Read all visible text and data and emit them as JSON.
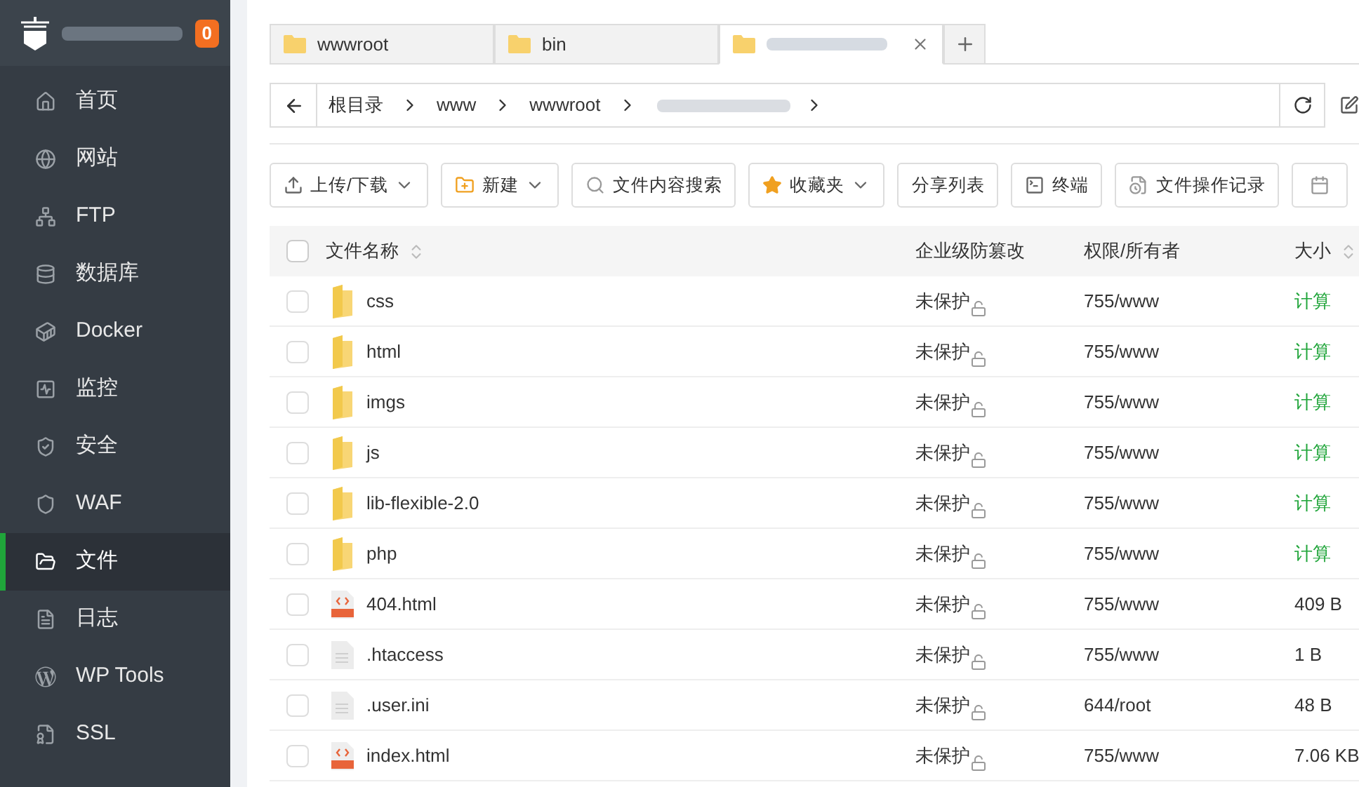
{
  "sidebar": {
    "badge": "0",
    "items": [
      {
        "label": "首页",
        "selected": false
      },
      {
        "label": "网站",
        "selected": false
      },
      {
        "label": "FTP",
        "selected": false
      },
      {
        "label": "数据库",
        "selected": false
      },
      {
        "label": "Docker",
        "selected": false
      },
      {
        "label": "监控",
        "selected": false
      },
      {
        "label": "安全",
        "selected": false
      },
      {
        "label": "WAF",
        "selected": false
      },
      {
        "label": "文件",
        "selected": true
      },
      {
        "label": "日志",
        "selected": false
      },
      {
        "label": "WP Tools",
        "selected": false
      },
      {
        "label": "SSL",
        "selected": false
      }
    ]
  },
  "tabs": [
    {
      "label": "wwwroot",
      "selected": false
    },
    {
      "label": "bin",
      "selected": false
    },
    {
      "selected": true
    }
  ],
  "breadcrumb": [
    "根目录",
    "www",
    "wwwroot"
  ],
  "toolbar": [
    {
      "label": "上传/下载",
      "dropdown": true
    },
    {
      "label": "新建",
      "dropdown": true
    },
    {
      "label": "文件内容搜索",
      "dropdown": false
    },
    {
      "label": "收藏夹",
      "dropdown": true
    },
    {
      "label": "分享列表",
      "dropdown": false
    },
    {
      "label": "终端",
      "dropdown": false
    },
    {
      "label": "文件操作记录",
      "dropdown": false
    }
  ],
  "table": {
    "all_checked": false,
    "columns": [
      {
        "label": "文件名称",
        "sortable": true
      },
      {
        "label": "企业级防篡改",
        "sortable": false
      },
      {
        "label": "权限/所有者",
        "sortable": false
      },
      {
        "label": "大小",
        "sortable": true
      }
    ],
    "rows": [
      {
        "kind": "folder",
        "name": "css",
        "protection": "未保护",
        "permission": "755/www",
        "size": "计算",
        "checked": false
      },
      {
        "kind": "folder",
        "name": "html",
        "protection": "未保护",
        "permission": "755/www",
        "size": "计算",
        "checked": false
      },
      {
        "kind": "folder",
        "name": "imgs",
        "protection": "未保护",
        "permission": "755/www",
        "size": "计算",
        "checked": false
      },
      {
        "kind": "folder",
        "name": "js",
        "protection": "未保护",
        "permission": "755/www",
        "size": "计算",
        "checked": false
      },
      {
        "kind": "folder",
        "name": "lib-flexible-2.0",
        "protection": "未保护",
        "permission": "755/www",
        "size": "计算",
        "checked": false
      },
      {
        "kind": "folder",
        "name": "php",
        "protection": "未保护",
        "permission": "755/www",
        "size": "计算",
        "checked": false
      },
      {
        "kind": "html",
        "name": "404.html",
        "protection": "未保护",
        "permission": "755/www",
        "size": "409 B",
        "checked": false
      },
      {
        "kind": "text",
        "name": ".htaccess",
        "protection": "未保护",
        "permission": "755/www",
        "size": "1 B",
        "checked": false
      },
      {
        "kind": "text",
        "name": ".user.ini",
        "protection": "未保护",
        "permission": "644/root",
        "size": "48 B",
        "checked": false
      },
      {
        "kind": "html",
        "name": "index.html",
        "protection": "未保护",
        "permission": "755/www",
        "size": "7.06 KB",
        "checked": false
      }
    ]
  }
}
